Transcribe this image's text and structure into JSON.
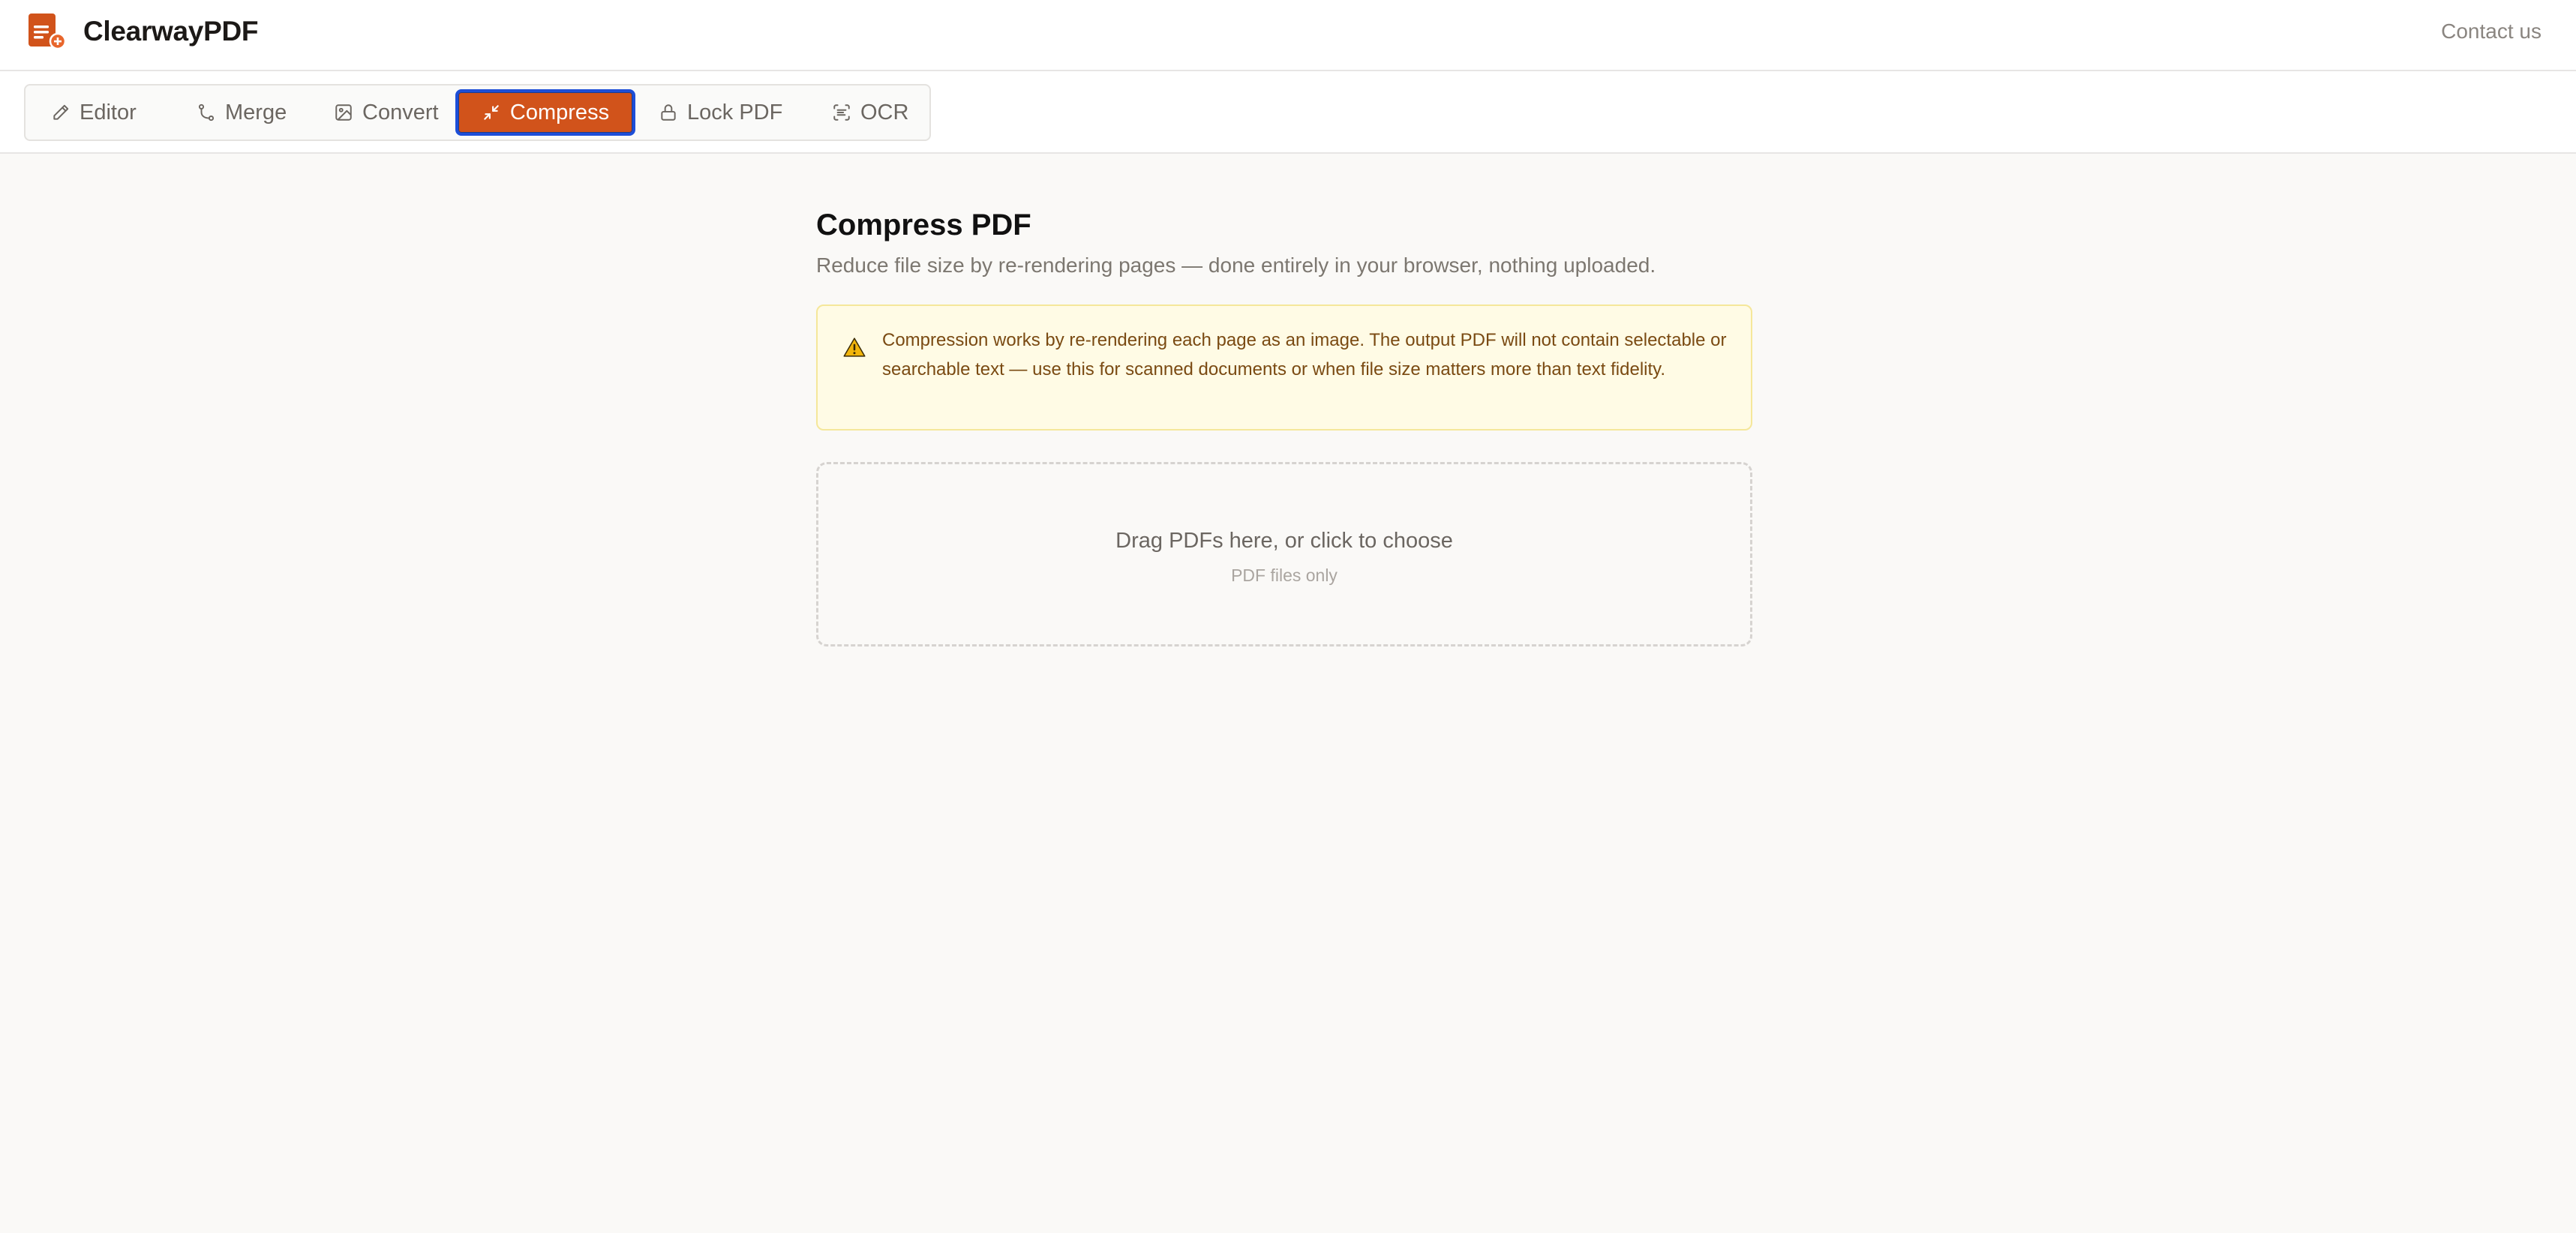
{
  "app": {
    "name": "ClearwayPDF",
    "contact_label": "Contact us",
    "accent_color": "#d1531b"
  },
  "tabs": [
    {
      "label": "Editor",
      "icon": "pencil-icon",
      "active": false
    },
    {
      "label": "Merge",
      "icon": "merge-icon",
      "active": false
    },
    {
      "label": "Convert",
      "icon": "image-icon",
      "active": false
    },
    {
      "label": "Compress",
      "icon": "compress-icon",
      "active": true
    },
    {
      "label": "Lock PDF",
      "icon": "lock-icon",
      "active": false
    },
    {
      "label": "OCR",
      "icon": "scan-text-icon",
      "active": false
    }
  ],
  "main": {
    "title": "Compress PDF",
    "subtitle": "Reduce file size by re-rendering pages — done entirely in your browser, nothing uploaded.",
    "warning": {
      "icon": "warning-icon",
      "text": "Compression works by re-rendering each page as an image. The output PDF will not contain selectable or searchable text — use this for scanned documents or when file size matters more than text fidelity."
    },
    "dropzone": {
      "title": "Drag PDFs here, or click to choose",
      "subtitle": "PDF files only"
    }
  }
}
